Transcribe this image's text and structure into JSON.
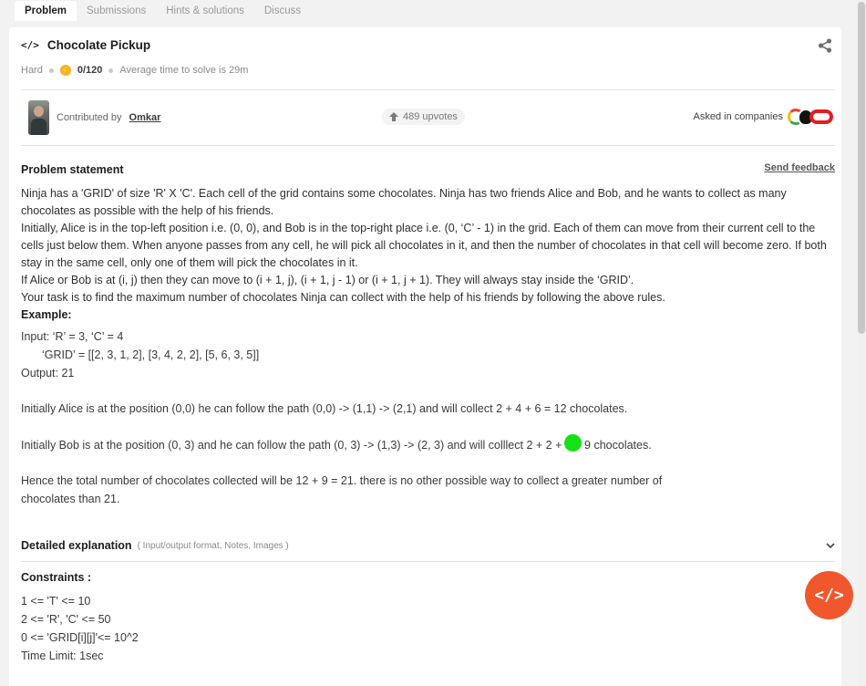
{
  "tabs": [
    "Problem",
    "Submissions",
    "Hints & solutions",
    "Discuss"
  ],
  "problem": {
    "title": "Chocolate Pickup",
    "difficulty": "Hard",
    "score": "0/120",
    "avg_time": "Average time to solve is 29m"
  },
  "contributor": {
    "prefix": "Contributed by",
    "name": "Omkar"
  },
  "upvotes": "489 upvotes",
  "companies_label": "Asked in companies",
  "statement": {
    "heading": "Problem statement",
    "feedback": "Send feedback",
    "paragraphs": [
      "Ninja has a 'GRID' of size 'R' X 'C'. Each cell of the grid contains some chocolates. Ninja has two friends Alice and Bob, and he wants to collect as many chocolates as possible with the help of his friends.",
      "Initially, Alice is in the top-left position i.e. (0, 0), and Bob is in the top-right place i.e. (0, ‘C’ - 1) in the grid. Each of them can move from their current cell to the cells just below them. When anyone passes from any cell, he will pick all chocolates in it, and then the number of chocolates in that cell will become zero. If both stay in the same cell, only one of them will pick the chocolates in it.",
      "If Alice or Bob is at (i, j) then they can move to (i + 1, j), (i + 1, j - 1) or (i + 1, j + 1). They will always stay inside the ‘GRID’.",
      "Your task is to find the maximum number of chocolates Ninja can collect with the help of his friends by following the above rules."
    ],
    "example_heading": "Example:",
    "input_line": "Input: ‘R’ = 3, ‘C’ = 4",
    "grid_line": "‘GRID’ = [[2, 3, 1, 2], [3, 4, 2, 2], [5, 6, 3, 5]]",
    "output_line": "Output: 21",
    "alice_line": "Initially Alice is at the position (0,0) he can follow the path (0,0) -> (1,1) -> (2,1) and will collect 2 + 4 + 6 = 12 chocolates.",
    "bob_line": "Initially Bob is at the position (0, 3) and he can follow the path (0, 3) -> (1,3) -> (2, 3) and will colllect 2 + 2 + 5 = 9 chocolates.",
    "total_line_1": "Hence the total number of chocolates collected will be 12 + 9 = 21. there is no other possible way to collect a greater number of",
    "total_line_2": "chocolates than 21."
  },
  "detailed": {
    "title": "Detailed explanation",
    "subtitle": "( Input/output format, Notes, Images )"
  },
  "constraints": {
    "heading": "Constraints :",
    "lines": [
      "1 <= 'T' <= 10",
      "2 <= 'R', 'C' <= 50",
      "0 <= 'GRID[i][j]'<= 10^2",
      "Time Limit: 1sec"
    ]
  },
  "icons": {
    "code": "code-icon",
    "share": "share-icon",
    "bolt": "bolt-icon",
    "upvote": "upvote-arrow-icon",
    "chevron": "chevron-down-icon"
  },
  "colors": {
    "accent": "#f1572d",
    "bolt": "#f5b324"
  }
}
